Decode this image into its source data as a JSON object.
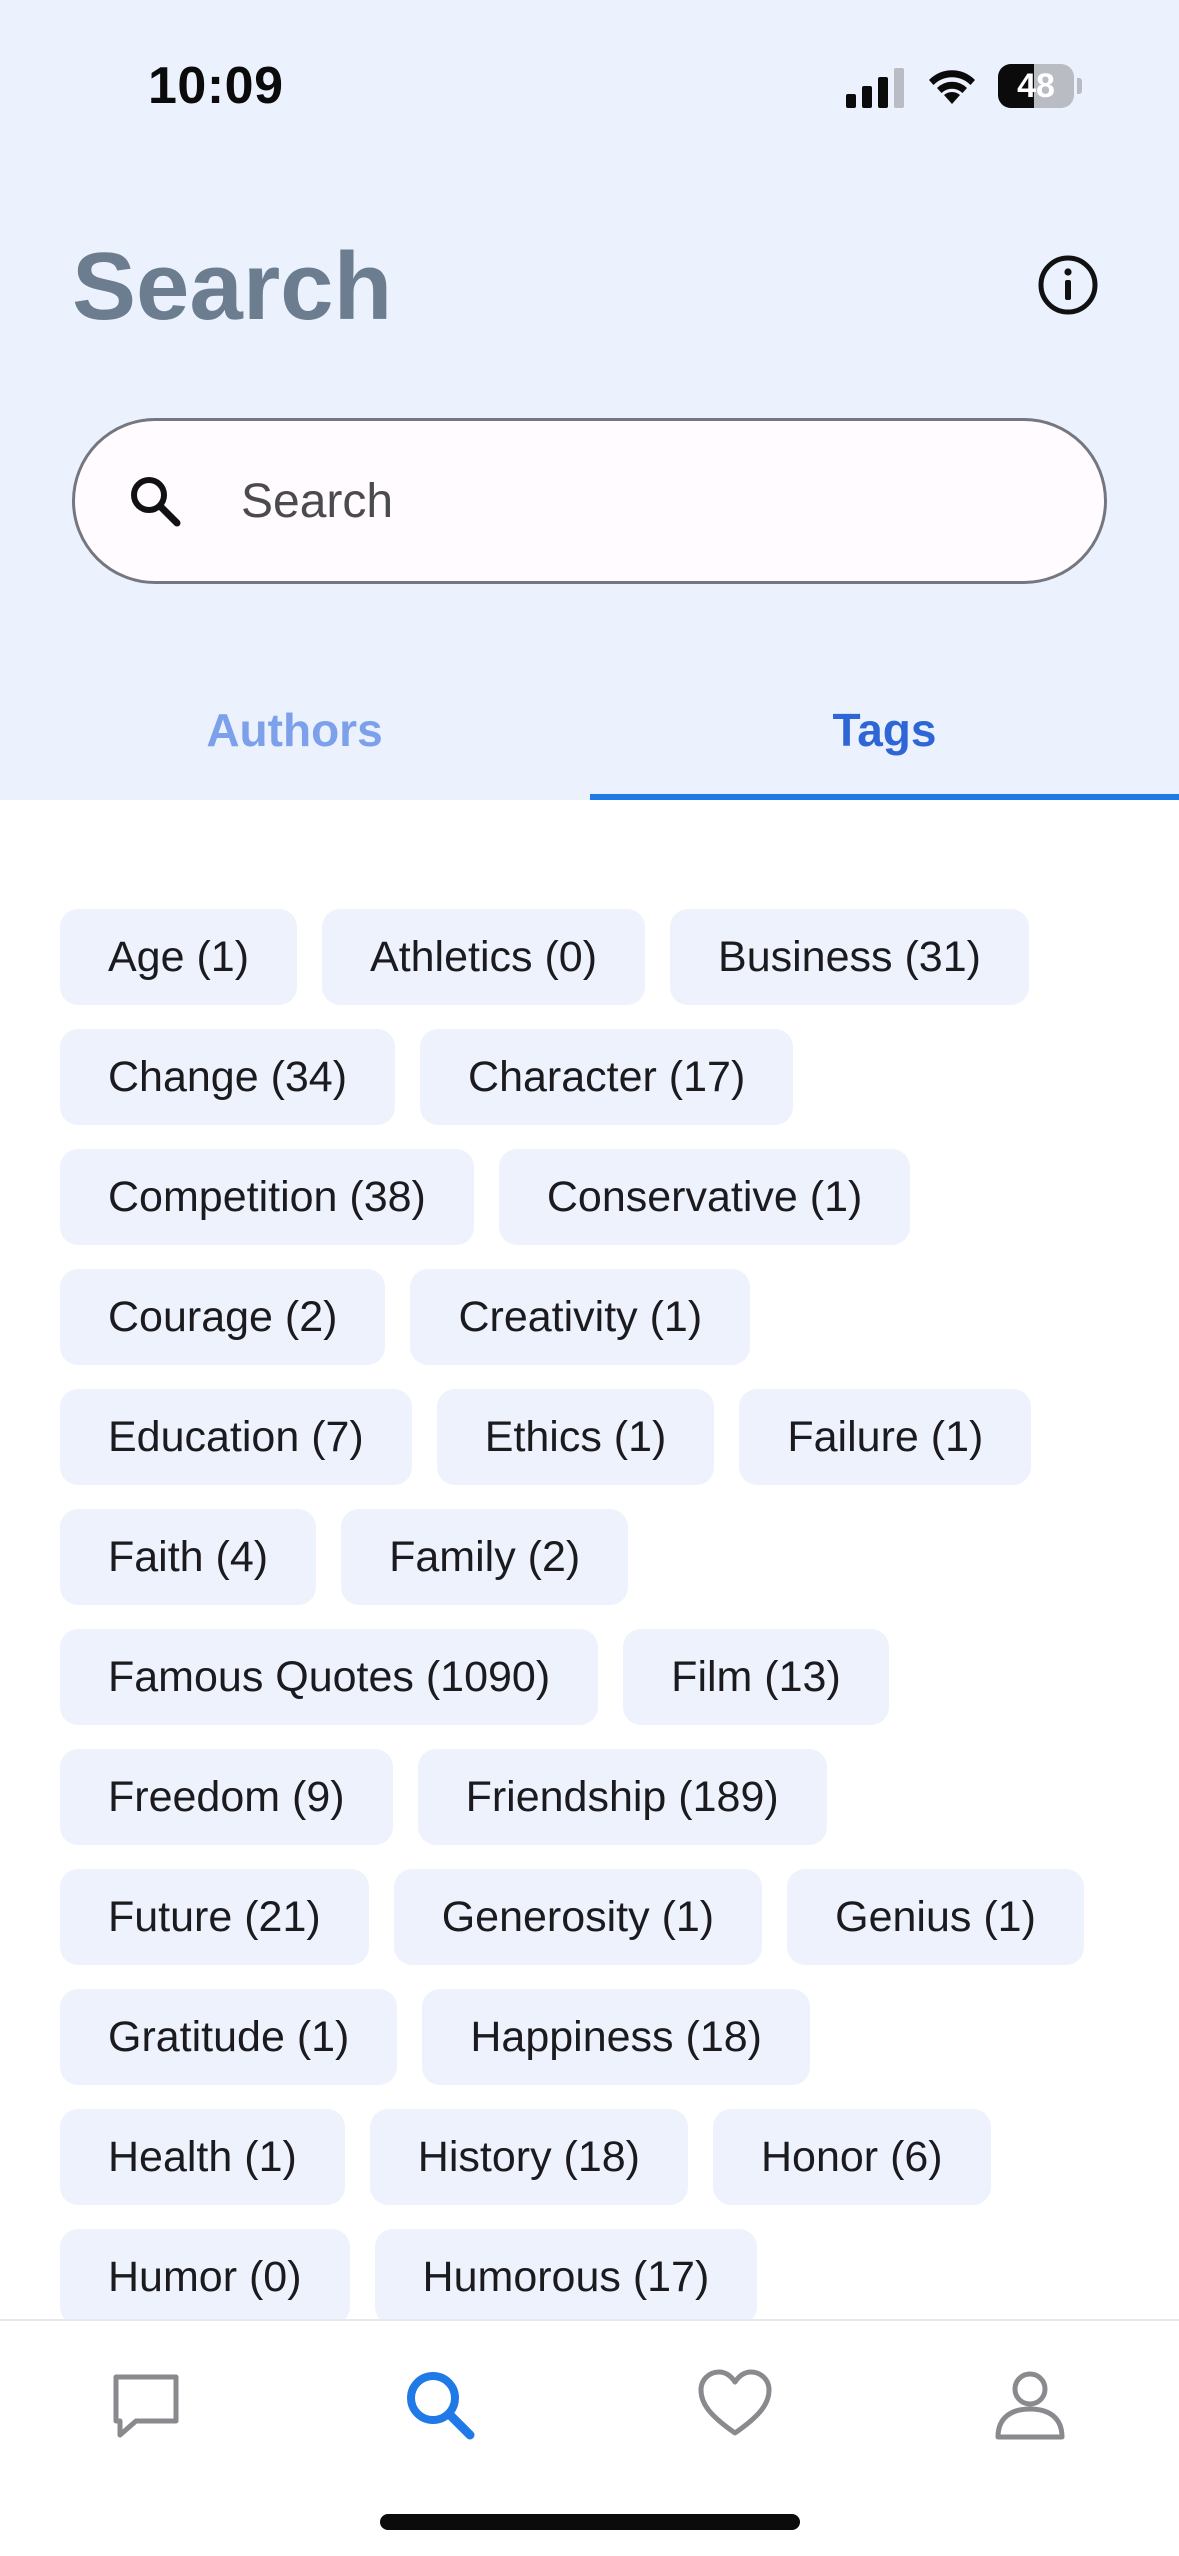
{
  "status_bar": {
    "time": "10:09",
    "battery": "48",
    "battery_level": 0.48
  },
  "header": {
    "title": "Search",
    "info_icon": "info-icon"
  },
  "search": {
    "placeholder": "Search",
    "value": ""
  },
  "tabs": [
    {
      "label": "Authors",
      "selected": false
    },
    {
      "label": "Tags",
      "selected": true
    }
  ],
  "tags": [
    "Age (1)",
    "Athletics (0)",
    "Business (31)",
    "Change (34)",
    "Character (17)",
    "Competition (38)",
    "Conservative (1)",
    "Courage (2)",
    "Creativity (1)",
    "Education (7)",
    "Ethics (1)",
    "Failure (1)",
    "Faith (4)",
    "Family (2)",
    "Famous Quotes (1090)",
    "Film (13)",
    "Freedom (9)",
    "Friendship (189)",
    "Future (21)",
    "Generosity (1)",
    "Genius (1)",
    "Gratitude (1)",
    "Happiness (18)",
    "Health (1)",
    "History (18)",
    "Honor (6)",
    "Humor (0)",
    "Humorous (17)"
  ],
  "bottom_nav": [
    {
      "icon": "chat-bubble-icon",
      "selected": false
    },
    {
      "icon": "search-icon",
      "selected": true
    },
    {
      "icon": "heart-icon",
      "selected": false
    },
    {
      "icon": "person-icon",
      "selected": false
    }
  ],
  "colors": {
    "header_bg": "#ecf2fd",
    "accent": "#1f7ae8",
    "chip_bg": "#edf2fc",
    "title": "#6b7d8f"
  }
}
